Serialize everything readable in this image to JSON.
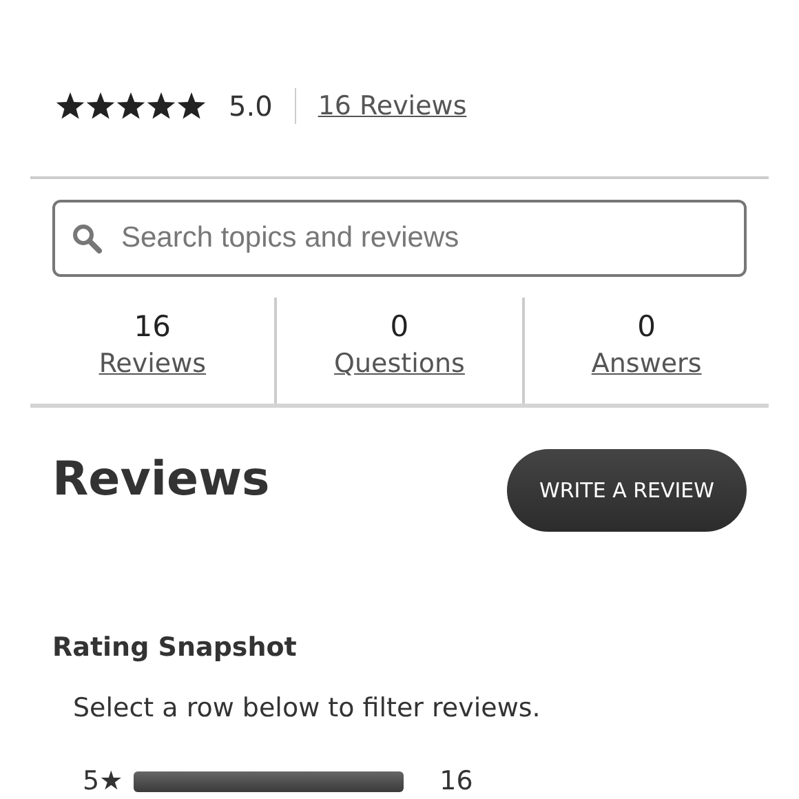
{
  "summary": {
    "stars": 5,
    "rating": "5.0",
    "reviews_link": "16 Reviews"
  },
  "search": {
    "placeholder": "Search topics and reviews"
  },
  "stats": [
    {
      "count": "16",
      "label": "Reviews"
    },
    {
      "count": "0",
      "label": "Questions"
    },
    {
      "count": "0",
      "label": "Answers"
    }
  ],
  "reviews": {
    "heading": "Reviews",
    "write_button": "WRITE A REVIEW"
  },
  "snapshot": {
    "title": "Rating Snapshot",
    "hint": "Select a row below to filter reviews.",
    "rows": [
      {
        "label": "5★",
        "level": 1.0,
        "count": "16"
      }
    ]
  }
}
